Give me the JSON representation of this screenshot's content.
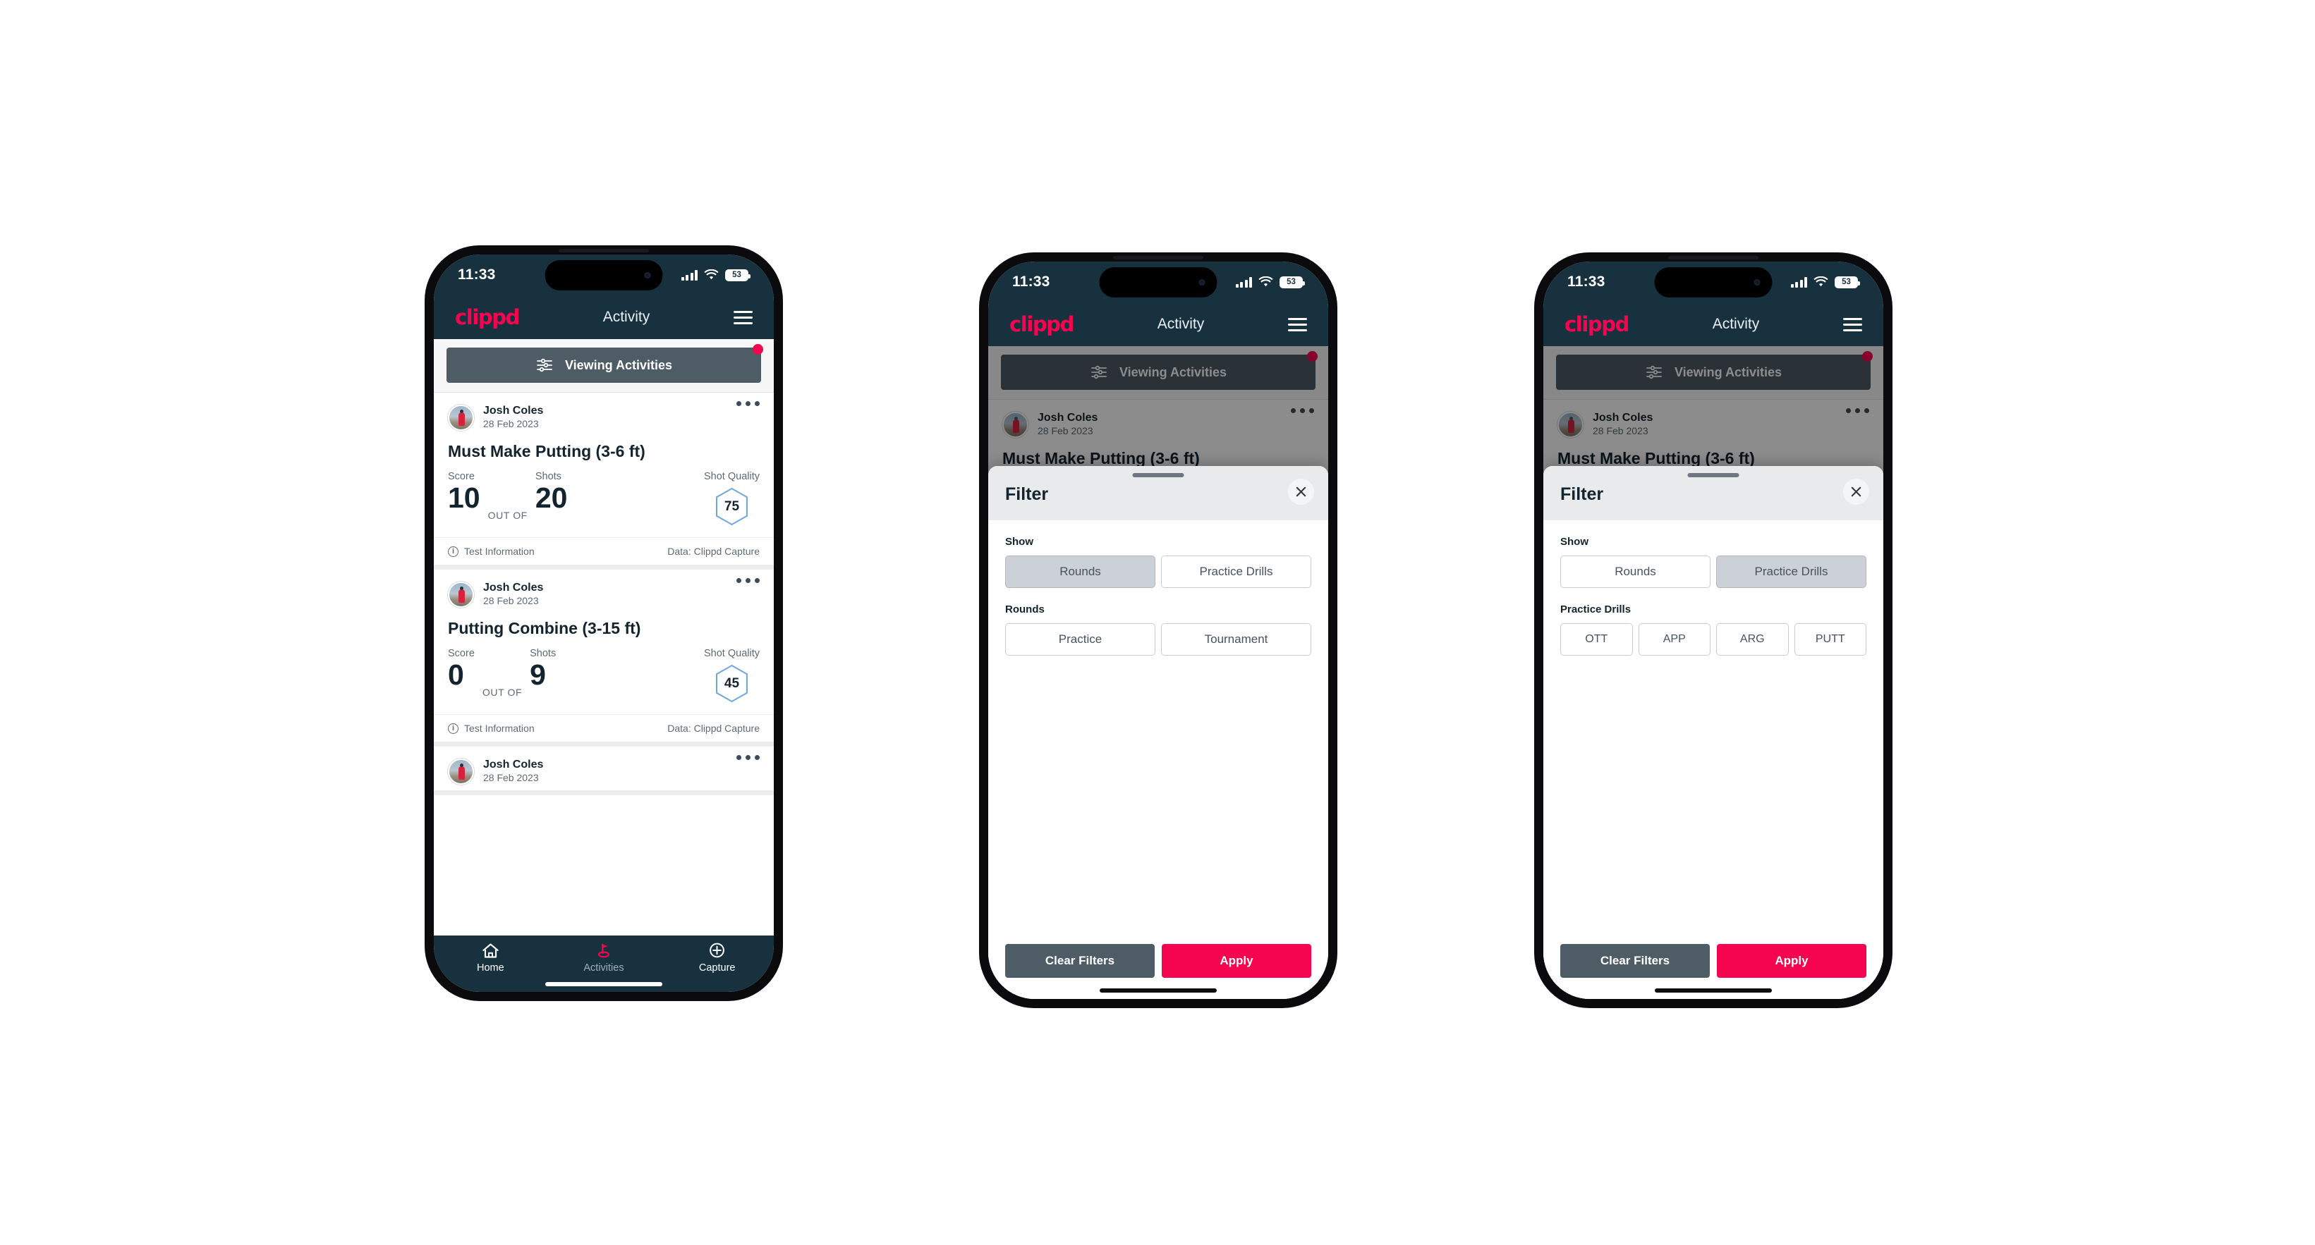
{
  "statusbar": {
    "time": "11:33",
    "battery": "53",
    "wifi_icon": "wifi-icon",
    "signal_icon": "cellular-signal-icon"
  },
  "appbar": {
    "logo": "clippd",
    "title": "Activity",
    "menu_icon": "hamburger-menu-icon"
  },
  "filterbar": {
    "label": "Viewing Activities",
    "icon": "tune-sliders-icon"
  },
  "cards": [
    {
      "user": "Josh Coles",
      "date": "28 Feb 2023",
      "title": "Must Make Putting (3-6 ft)",
      "score_label": "Score",
      "score_value": "10",
      "outof_label": "OUT OF",
      "shots_label": "Shots",
      "shots_value": "20",
      "quality_label": "Shot Quality",
      "quality_value": "75",
      "footer_left": "Test Information",
      "footer_right": "Data: Clippd Capture"
    },
    {
      "user": "Josh Coles",
      "date": "28 Feb 2023",
      "title": "Putting Combine (3-15 ft)",
      "score_label": "Score",
      "score_value": "0",
      "outof_label": "OUT OF",
      "shots_label": "Shots",
      "shots_value": "9",
      "quality_label": "Shot Quality",
      "quality_value": "45",
      "footer_left": "Test Information",
      "footer_right": "Data: Clippd Capture"
    },
    {
      "user": "Josh Coles",
      "date": "28 Feb 2023"
    }
  ],
  "bottomnav": {
    "items": [
      {
        "label": "Home",
        "icon": "home-icon",
        "active": false
      },
      {
        "label": "Activities",
        "icon": "golf-flag-icon",
        "active": true
      },
      {
        "label": "Capture",
        "icon": "plus-circle-icon",
        "active": false
      }
    ]
  },
  "filter_sheet": {
    "title": "Filter",
    "close_icon": "close-x-icon",
    "show_label": "Show",
    "show_options": [
      "Rounds",
      "Practice Drills"
    ],
    "rounds_label": "Rounds",
    "rounds_options": [
      "Practice",
      "Tournament"
    ],
    "drills_label": "Practice Drills",
    "drills_options": [
      "OTT",
      "APP",
      "ARG",
      "PUTT"
    ],
    "clear_label": "Clear Filters",
    "apply_label": "Apply",
    "phone2_selected_show": "Rounds",
    "phone3_selected_show": "Practice Drills"
  },
  "colors": {
    "brand_pink": "#f5054f",
    "header_navy": "#17313f",
    "slate": "#4e5c66",
    "hex_blue": "#6fa8dc"
  }
}
